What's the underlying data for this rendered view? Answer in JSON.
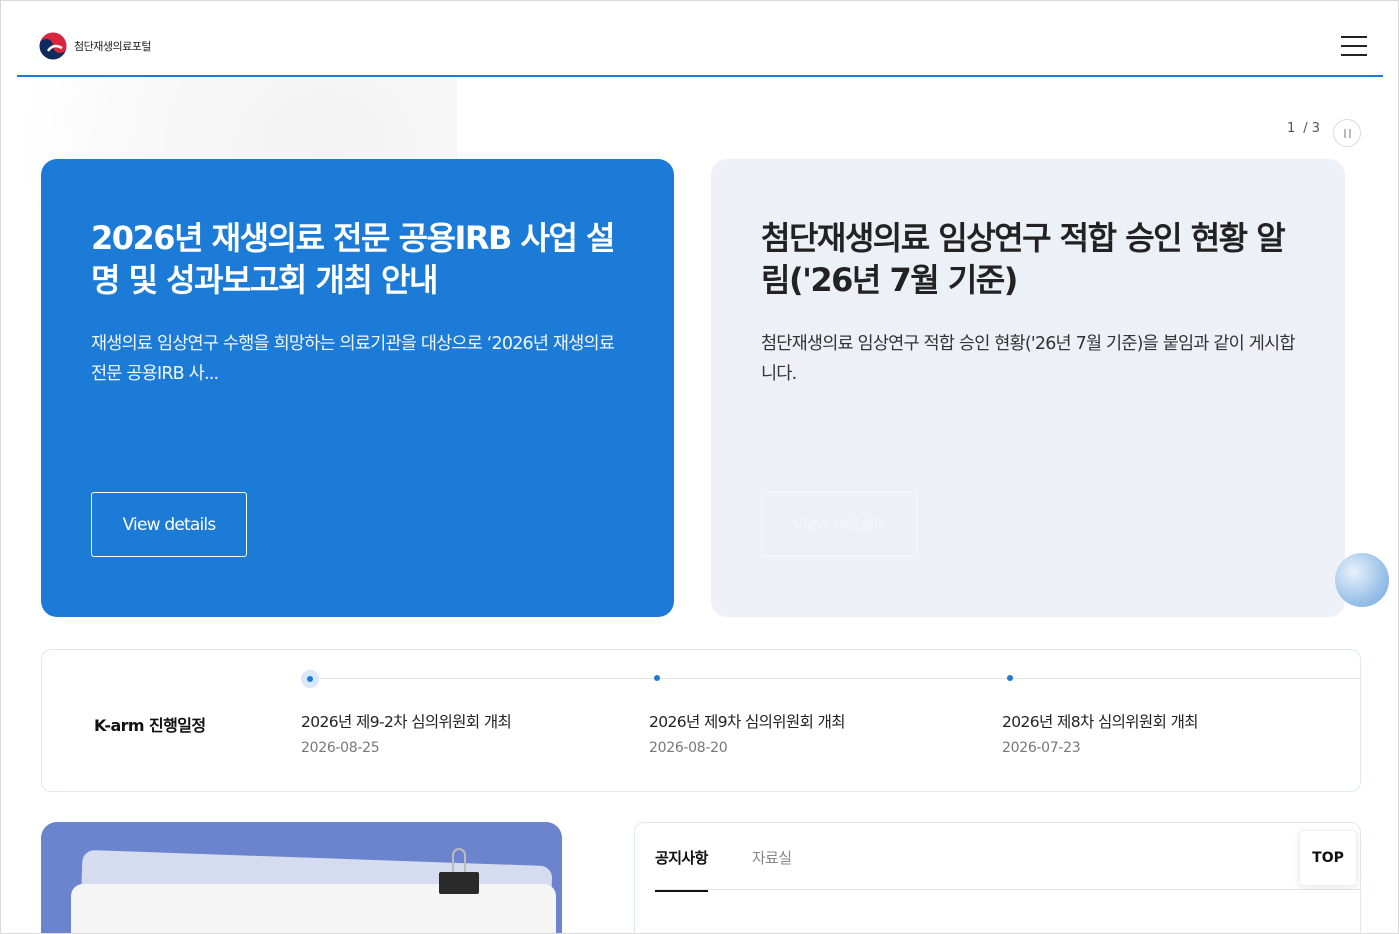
{
  "header": {
    "logo_text": "첨단재생의료포털"
  },
  "slider": {
    "current": "1",
    "total": "/ 3"
  },
  "cards": [
    {
      "title": "2026년 재생의료 전문 공용IRB 사업 설명 및 성과보고회 개최 안내",
      "desc": "재생의료 임상연구 수행을 희망하는 의료기관을 대상으로 ‘2026년 재생의료 전문 공용IRB 사...",
      "button": "View details"
    },
    {
      "title": "첨단재생의료 임상연구 적합 승인 현황 알림('26년 7월 기준)",
      "desc": "첨단재생의료 임상연구 적합 승인 현황('26년 7월 기준)을 붙임과 같이 게시합니다.",
      "button": "View details"
    }
  ],
  "schedule": {
    "title": "K-arm 진행일정",
    "items": [
      {
        "name": "2026년 제9-2차 심의위원회 개최",
        "date": "2026-08-25"
      },
      {
        "name": "2026년 제9차 심의위원회 개최",
        "date": "2026-08-20"
      },
      {
        "name": "2026년 제8차 심의위원회 개최",
        "date": "2026-07-23"
      }
    ]
  },
  "notice": {
    "tabs": [
      {
        "label": "공지사항"
      },
      {
        "label": "자료실"
      }
    ]
  },
  "top_button": "TOP",
  "colors": {
    "accent": "#1b7bd6",
    "card_gray": "#edf1f7",
    "banner": "#6c83ce"
  }
}
